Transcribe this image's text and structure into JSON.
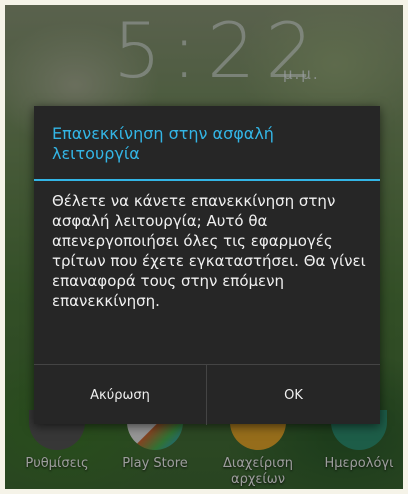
{
  "home": {
    "clock": "5:22",
    "clock_suffix": "μ.μ."
  },
  "dock": {
    "apps": [
      {
        "label": "Ρυθμίσεις",
        "color": "#4a4a4a"
      },
      {
        "label": "Play Store",
        "color": "#e8e8e8"
      },
      {
        "label": "Διαχείριση αρχείων",
        "color": "#e6a82a"
      },
      {
        "label": "Ημερολόγι",
        "color": "#2d8f6f"
      }
    ]
  },
  "dialog": {
    "title": "Επανεκκίνηση στην ασφαλή λειτουργία",
    "message": "Θέλετε να κάνετε επανεκκίνηση στην ασφαλή λειτουργία; Αυτό θα απενεργοποιήσει όλες τις εφαρμογές τρίτων που έχετε εγκαταστήσει. Θα γίνει επαναφορά τους στην επόμενη επανεκκίνηση.",
    "cancel_label": "Ακύρωση",
    "ok_label": "OK",
    "accent_color": "#33b5e5"
  }
}
